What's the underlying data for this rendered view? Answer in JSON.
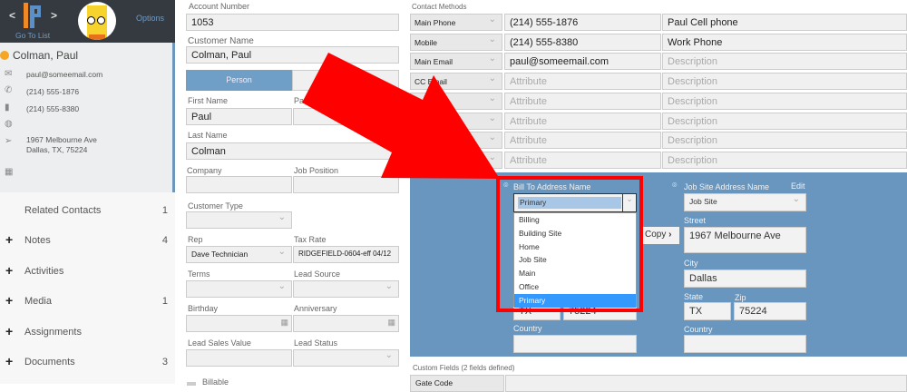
{
  "header": {
    "prev": "<",
    "next": ">",
    "go_to_list": "Go To List",
    "options": "Options",
    "logo": "iP"
  },
  "contact": {
    "name": "Colman, Paul",
    "email": "paul@someemail.com",
    "phone": "(214) 555-1876",
    "mobile": "(214) 555-8380",
    "address1": "1967 Melbourne Ave",
    "address2": "Dallas, TX, 75224",
    "status_color": "#f5a623"
  },
  "nav": [
    {
      "label": "Related Contacts",
      "count": "1",
      "plus": false
    },
    {
      "label": "Notes",
      "count": "4",
      "plus": true
    },
    {
      "label": "Activities",
      "count": "",
      "plus": true
    },
    {
      "label": "Media",
      "count": "1",
      "plus": true
    },
    {
      "label": "Assignments",
      "count": "",
      "plus": true
    },
    {
      "label": "Documents",
      "count": "3",
      "plus": true
    }
  ],
  "form": {
    "account_number_label": "Account Number",
    "account_number": "1053",
    "customer_name_label": "Customer Name",
    "customer_name": "Colman, Paul",
    "person_tab": "Person",
    "first_name_label": "First Name",
    "first_name": "Paul",
    "pa_label": "Pa",
    "last_name_label": "Last Name",
    "last_name": "Colman",
    "company_label": "Company",
    "job_position_label": "Job Position",
    "customer_type_label": "Customer Type",
    "rep_label": "Rep",
    "rep": "Dave Technician",
    "tax_rate_label": "Tax Rate",
    "tax_rate": "RIDGEFIELD-0604-eff 04/12",
    "terms_label": "Terms",
    "lead_source_label": "Lead Source",
    "birthday_label": "Birthday",
    "anniversary_label": "Anniversary",
    "lead_sales_value_label": "Lead Sales Value",
    "lead_status_label": "Lead Status",
    "billable_label": "Billable"
  },
  "contact_methods": {
    "title": "Contact Methods",
    "rows": [
      {
        "type": "Main Phone",
        "value": "(214) 555-1876",
        "desc": "Paul Cell phone"
      },
      {
        "type": "Mobile",
        "value": "(214) 555-8380",
        "desc": "Work Phone"
      },
      {
        "type": "Main Email",
        "value": "paul@someemail.com",
        "desc": ""
      },
      {
        "type": "CC Email",
        "value": "",
        "desc": ""
      },
      {
        "type": "",
        "value": "",
        "desc": ""
      },
      {
        "type": "",
        "value": "",
        "desc": ""
      },
      {
        "type": "",
        "value": "",
        "desc": ""
      },
      {
        "type": "",
        "value": "",
        "desc": ""
      }
    ],
    "value_placeholder": "Attribute",
    "desc_placeholder": "Description"
  },
  "bill_to": {
    "label": "Bill To Address Name",
    "selected": "Primary",
    "options": [
      "Billing",
      "Building Site",
      "Home",
      "Job Site",
      "Main",
      "Office",
      "Primary"
    ],
    "state": "TX",
    "zip": "75224",
    "country_label": "Country"
  },
  "copy_button": "Copy",
  "job_site": {
    "label": "Job Site Address Name",
    "edit": "Edit",
    "selected": "Job Site",
    "street_label": "Street",
    "street": "1967 Melbourne Ave",
    "city_label": "City",
    "city": "Dallas",
    "state_label": "State",
    "state": "TX",
    "zip_label": "Zip",
    "zip": "75224",
    "country_label": "Country"
  },
  "custom_fields": {
    "title": "Custom Fields  (2 fields defined)",
    "first_field": "Gate Code"
  },
  "annotation_color": "#ff0000"
}
